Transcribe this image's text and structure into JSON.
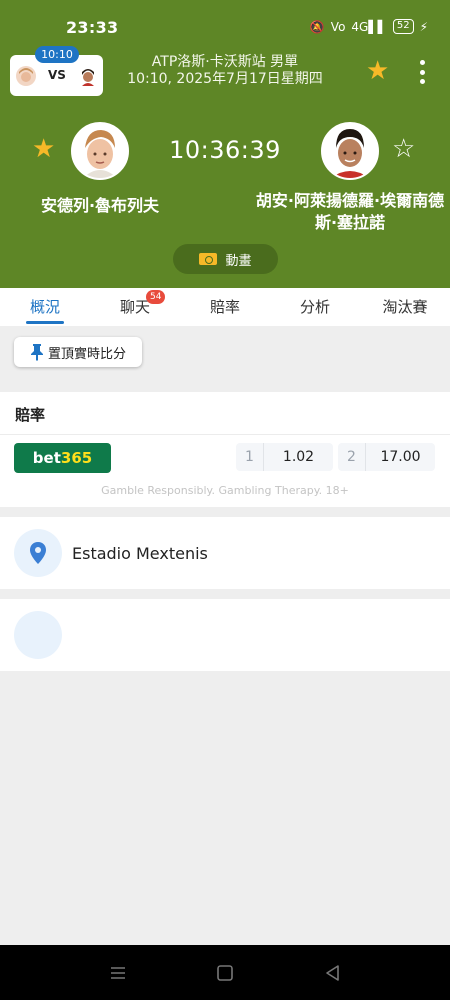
{
  "status_bar": {
    "time": "23:33",
    "icons": [
      "do-not-disturb-icon",
      "volte-icon",
      "4g-signal-icon",
      "battery-icon",
      "charging-icon"
    ],
    "net_label_1": "Vo",
    "net_label_2": "4G",
    "battery": "52"
  },
  "header": {
    "mini_time": "10:10",
    "vs_label": "VS",
    "tournament": "ATP洛斯·卡沃斯站 男單",
    "datetime": "10:10, 2025年7月17日星期四",
    "clock": "10:36:39",
    "player_left": "安德列·魯布列夫",
    "player_right": "胡安·阿萊揚德羅·埃爾南德斯·塞拉諾",
    "animation_label": "動畫"
  },
  "tabs": [
    {
      "label": "概況",
      "active": true
    },
    {
      "label": "聊天",
      "badge": "54"
    },
    {
      "label": "賠率"
    },
    {
      "label": "分析"
    },
    {
      "label": "淘汰賽"
    }
  ],
  "pin_button": "置頂實時比分",
  "odds": {
    "title": "賠率",
    "bookmaker_a": "bet",
    "bookmaker_b": "365",
    "home_label": "1",
    "home_value": "1.02",
    "away_label": "2",
    "away_value": "17.00",
    "note": "Gamble Responsibly. Gambling Therapy. 18+"
  },
  "venue": {
    "name": "Estadio Mextenis"
  },
  "colors": {
    "header_bg": "#5e8626",
    "accent": "#1e74c4",
    "star": "#f7b928",
    "bet365_green": "#0f7a4a",
    "bet365_yellow": "#ffdf1b",
    "badge": "#e84b3c"
  }
}
